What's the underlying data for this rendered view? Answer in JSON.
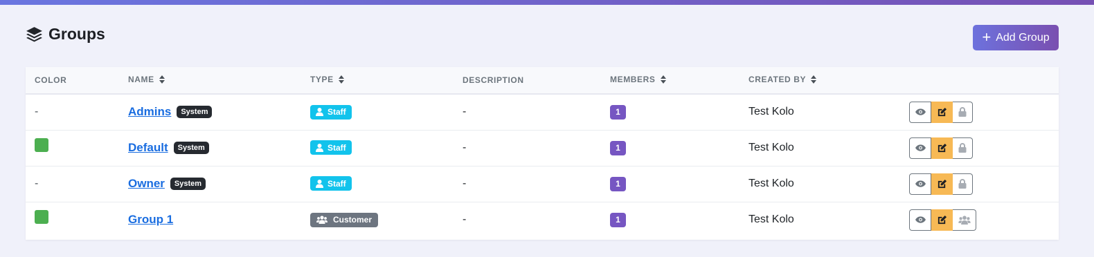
{
  "header": {
    "title": "Groups",
    "title_icon": "layer-group-icon",
    "add_button_label": "Add Group",
    "add_button_icon": "plus-icon"
  },
  "table": {
    "columns": {
      "color": "COLOR",
      "name": "NAME",
      "type": "TYPE",
      "description": "DESCRIPTION",
      "members": "MEMBERS",
      "created_by": "CREATED BY"
    },
    "rows": [
      {
        "color": "-",
        "has_swatch": false,
        "name": "Admins",
        "badge": "System",
        "type": "Staff",
        "description": "-",
        "members": "1",
        "created_by": "Test Kolo",
        "third_action": "lock-icon"
      },
      {
        "color": "#4caf50",
        "has_swatch": true,
        "name": "Default",
        "badge": "System",
        "type": "Staff",
        "description": "-",
        "members": "1",
        "created_by": "Test Kolo",
        "third_action": "lock-icon"
      },
      {
        "color": "-",
        "has_swatch": false,
        "name": "Owner",
        "badge": "System",
        "type": "Staff",
        "description": "-",
        "members": "1",
        "created_by": "Test Kolo",
        "third_action": "lock-icon"
      },
      {
        "color": "#4caf50",
        "has_swatch": true,
        "name": "Group 1",
        "badge": "",
        "type": "Customer",
        "description": "-",
        "members": "1",
        "created_by": "Test Kolo",
        "third_action": "users-icon"
      }
    ]
  },
  "colors": {
    "accent_start": "#6d72dd",
    "accent_end": "#7a4fb0",
    "staff_badge": "#12c3ec",
    "customer_badge": "#6d7580",
    "member_badge": "#7656c2",
    "edit_button": "#f7b955",
    "link": "#1a6de0"
  }
}
